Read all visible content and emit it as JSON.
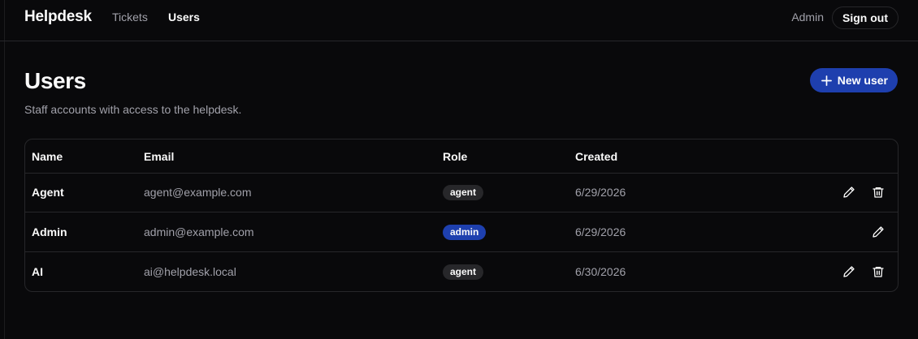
{
  "header": {
    "brand": "Helpdesk",
    "nav": [
      {
        "label": "Tickets",
        "active": false
      },
      {
        "label": "Users",
        "active": true
      }
    ],
    "current_user": "Admin",
    "sign_out_label": "Sign out"
  },
  "page": {
    "title": "Users",
    "subtitle": "Staff accounts with access to the helpdesk.",
    "new_user_label": "New user"
  },
  "table": {
    "columns": [
      "Name",
      "Email",
      "Role",
      "Created"
    ],
    "rows": [
      {
        "name": "Agent",
        "email": "agent@example.com",
        "role": "agent",
        "created": "6/29/2026",
        "actions": [
          "pencil-icon",
          "trash-icon"
        ]
      },
      {
        "name": "Admin",
        "email": "admin@example.com",
        "role": "admin",
        "created": "6/29/2026",
        "actions": [
          "pencil-icon"
        ]
      },
      {
        "name": "AI",
        "email": "ai@helpdesk.local",
        "role": "agent",
        "created": "6/30/2026",
        "actions": [
          "pencil-icon",
          "trash-icon"
        ]
      }
    ]
  },
  "colors": {
    "background": "#09090b",
    "border": "#27272a",
    "accent": "#1e40af",
    "muted_text": "#a1a1aa"
  }
}
